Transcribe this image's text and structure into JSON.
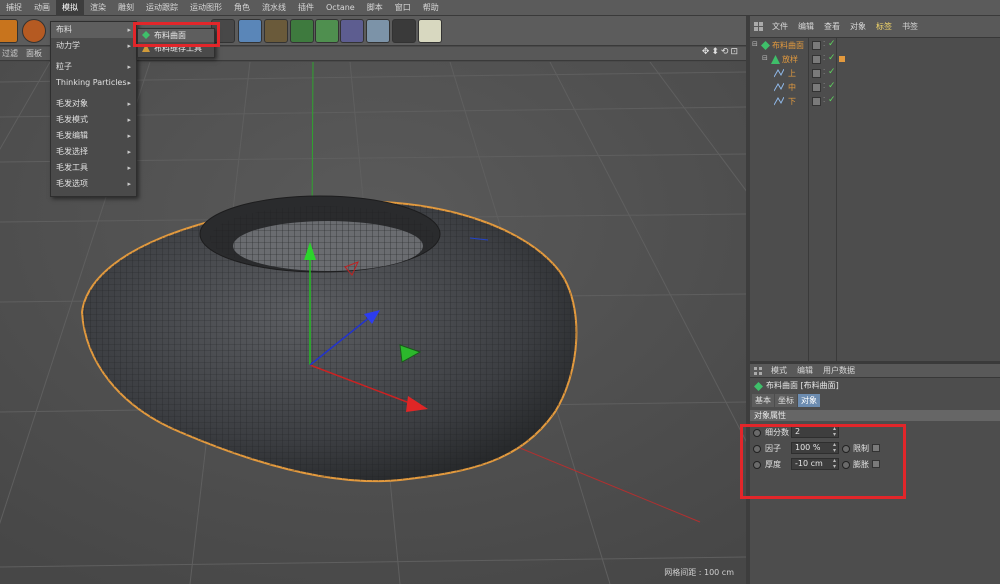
{
  "menubar": [
    "捕捉",
    "动画",
    "模拟",
    "渲染",
    "雕刻",
    "运动跟踪",
    "运动图形",
    "角色",
    "流水线",
    "插件",
    "Octane",
    "脚本",
    "窗口",
    "帮助"
  ],
  "viewport_header": {
    "left1": "过滤",
    "left2": "面板"
  },
  "viewport_nav": "✥⬍⟲⊡",
  "dropdown": {
    "items": [
      {
        "label": "布料",
        "arrow": "▸"
      },
      {
        "label": "动力学",
        "arrow": "▸"
      },
      {
        "label": "粒子",
        "arrow": "▸"
      },
      {
        "label": "Thinking Particles",
        "arrow": "▸"
      },
      {
        "label": "毛发对象",
        "arrow": "▸"
      },
      {
        "label": "毛发模式",
        "arrow": "▸"
      },
      {
        "label": "毛发编辑",
        "arrow": "▸"
      },
      {
        "label": "毛发选择",
        "arrow": "▸"
      },
      {
        "label": "毛发工具",
        "arrow": "▸"
      },
      {
        "label": "毛发选项",
        "arrow": "▸"
      }
    ]
  },
  "submenu": {
    "item1": "布料曲面",
    "item2": "布料缝存工具"
  },
  "object_manager": {
    "tabs": [
      "文件",
      "编辑",
      "查看",
      "对象",
      "标签",
      "书签"
    ],
    "rows": [
      {
        "name": "布料曲面",
        "level": 0
      },
      {
        "name": "放样",
        "level": 1
      },
      {
        "name": "上",
        "level": 2
      },
      {
        "name": "中",
        "level": 2
      },
      {
        "name": "下",
        "level": 2
      }
    ]
  },
  "attributes": {
    "tabs": [
      "模式",
      "编辑",
      "用户数据"
    ],
    "object_title": "布料曲面 [布料曲面]",
    "sub_tabs": [
      "基本",
      "坐标",
      "对象"
    ],
    "section": "对象属性",
    "subdivisions_label": "细分数",
    "subdivisions_value": "2",
    "factor_label": "因子",
    "factor_value": "100 %",
    "limit_label": "限制",
    "thickness_label": "厚度",
    "thickness_value": "-10 cm",
    "bevel_label": "膨胀"
  },
  "grid_spacing": "网格间距 : 100 cm",
  "colors": {
    "highlight": "#e2262a",
    "selection_orange": "#e39a3e",
    "axis_x": "#d22",
    "axis_y": "#2c2",
    "axis_z": "#22d"
  }
}
